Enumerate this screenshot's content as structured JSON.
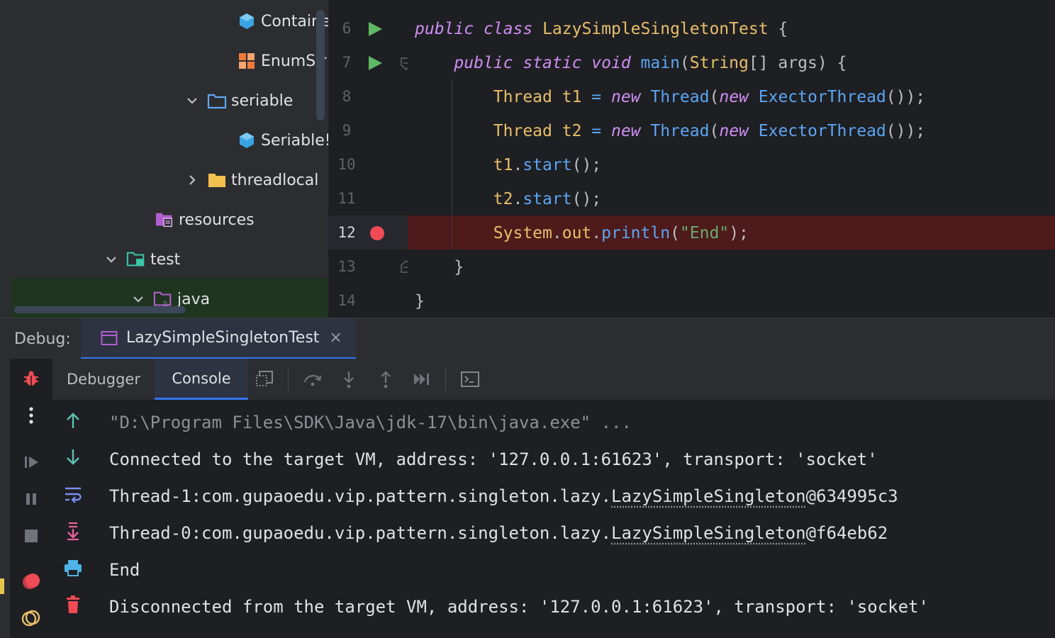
{
  "tree": {
    "items": [
      {
        "label": "Containe",
        "kind": "class",
        "icon": "class-icon"
      },
      {
        "label": "EnumSir",
        "kind": "enum",
        "icon": "enum-icon"
      },
      {
        "label": "seriable",
        "kind": "package",
        "icon": "package-icon",
        "expanded": true
      },
      {
        "label": "Seriable!",
        "kind": "class",
        "icon": "class-icon"
      },
      {
        "label": "threadlocal",
        "kind": "folder",
        "icon": "folder-icon",
        "expanded": false
      },
      {
        "label": "resources",
        "kind": "resources",
        "icon": "resources-folder-icon"
      },
      {
        "label": "test",
        "kind": "test-folder",
        "icon": "test-folder-icon",
        "expanded": true
      },
      {
        "label": "java",
        "kind": "test-java",
        "icon": "java-folder-icon",
        "expanded": true
      }
    ]
  },
  "editor": {
    "line_numbers": [
      "6",
      "7",
      "8",
      "9",
      "10",
      "11",
      "12",
      "13",
      "14"
    ],
    "current_line": "12",
    "lines": [
      [
        {
          "t": "public",
          "c": "kw"
        },
        {
          "t": " ",
          "c": "plain"
        },
        {
          "t": "class",
          "c": "kw"
        },
        {
          "t": " ",
          "c": "plain"
        },
        {
          "t": "LazySimpleSingletonTest",
          "c": "cls"
        },
        {
          "t": " {",
          "c": "plain"
        }
      ],
      [
        {
          "t": "    public",
          "c": "kw"
        },
        {
          "t": " ",
          "c": "plain"
        },
        {
          "t": "static",
          "c": "kw"
        },
        {
          "t": " ",
          "c": "plain"
        },
        {
          "t": "void",
          "c": "kw"
        },
        {
          "t": " ",
          "c": "plain"
        },
        {
          "t": "main",
          "c": "fn"
        },
        {
          "t": "(",
          "c": "plain"
        },
        {
          "t": "String",
          "c": "cls"
        },
        {
          "t": "[] args) {",
          "c": "plain"
        }
      ],
      [
        {
          "t": "        Thread",
          "c": "cls"
        },
        {
          "t": " ",
          "c": "plain"
        },
        {
          "t": "t1",
          "c": "var"
        },
        {
          "t": " = ",
          "c": "op"
        },
        {
          "t": "new",
          "c": "kw"
        },
        {
          "t": " ",
          "c": "plain"
        },
        {
          "t": "Thread",
          "c": "cls2"
        },
        {
          "t": "(",
          "c": "plain"
        },
        {
          "t": "new",
          "c": "kw"
        },
        {
          "t": " ",
          "c": "plain"
        },
        {
          "t": "ExectorThread",
          "c": "cls2"
        },
        {
          "t": "());",
          "c": "plain"
        }
      ],
      [
        {
          "t": "        Thread",
          "c": "cls"
        },
        {
          "t": " ",
          "c": "plain"
        },
        {
          "t": "t2",
          "c": "var"
        },
        {
          "t": " = ",
          "c": "op"
        },
        {
          "t": "new",
          "c": "kw"
        },
        {
          "t": " ",
          "c": "plain"
        },
        {
          "t": "Thread",
          "c": "cls2"
        },
        {
          "t": "(",
          "c": "plain"
        },
        {
          "t": "new",
          "c": "kw"
        },
        {
          "t": " ",
          "c": "plain"
        },
        {
          "t": "ExectorThread",
          "c": "cls2"
        },
        {
          "t": "());",
          "c": "plain"
        }
      ],
      [
        {
          "t": "        t1",
          "c": "var"
        },
        {
          "t": ".",
          "c": "plain"
        },
        {
          "t": "start",
          "c": "fn"
        },
        {
          "t": "();",
          "c": "plain"
        }
      ],
      [
        {
          "t": "        t2",
          "c": "var"
        },
        {
          "t": ".",
          "c": "plain"
        },
        {
          "t": "start",
          "c": "fn"
        },
        {
          "t": "();",
          "c": "plain"
        }
      ],
      [
        {
          "t": "        System",
          "c": "cls"
        },
        {
          "t": ".",
          "c": "plain"
        },
        {
          "t": "out",
          "c": "var"
        },
        {
          "t": ".",
          "c": "plain"
        },
        {
          "t": "println",
          "c": "fn"
        },
        {
          "t": "(",
          "c": "plain"
        },
        {
          "t": "\"End\"",
          "c": "str"
        },
        {
          "t": ");",
          "c": "plain"
        }
      ],
      [
        {
          "t": "    }",
          "c": "plain"
        }
      ],
      [
        {
          "t": "}",
          "c": "plain"
        }
      ]
    ]
  },
  "debug": {
    "label": "Debug:",
    "tab_title": "LazySimpleSingletonTest",
    "close_glyph": "×",
    "subtabs": {
      "debugger": "Debugger",
      "console": "Console"
    }
  },
  "console": {
    "lines": [
      {
        "segments": [
          {
            "t": "\"D:\\Program Files\\SDK\\Java\\jdk-17\\bin\\java.exe\" ...",
            "link": false
          }
        ],
        "kind": "cmd"
      },
      {
        "segments": [
          {
            "t": "Connected to the target VM, address: '127.0.0.1:61623', transport: 'socket'",
            "link": false
          }
        ],
        "kind": "out"
      },
      {
        "segments": [
          {
            "t": "Thread-1:com.gupaoedu.vip.pattern.singleton.lazy.",
            "link": false
          },
          {
            "t": "LazySimpleSingleton",
            "link": true
          },
          {
            "t": "@634995c3",
            "link": false
          }
        ],
        "kind": "out"
      },
      {
        "segments": [
          {
            "t": "Thread-0:com.gupaoedu.vip.pattern.singleton.lazy.",
            "link": false
          },
          {
            "t": "LazySimpleSingleton",
            "link": true
          },
          {
            "t": "@f64eb62",
            "link": false
          }
        ],
        "kind": "out"
      },
      {
        "segments": [
          {
            "t": "End",
            "link": false
          }
        ],
        "kind": "out"
      },
      {
        "segments": [
          {
            "t": "Disconnected from the target VM, address: '127.0.0.1:61623', transport: 'socket'",
            "link": false
          }
        ],
        "kind": "out"
      }
    ]
  },
  "colors": {
    "accent": "#3574f0",
    "breakpoint": "#f04b55",
    "run": "#5fb865",
    "breakpoint_line": "#4e1a1a"
  }
}
